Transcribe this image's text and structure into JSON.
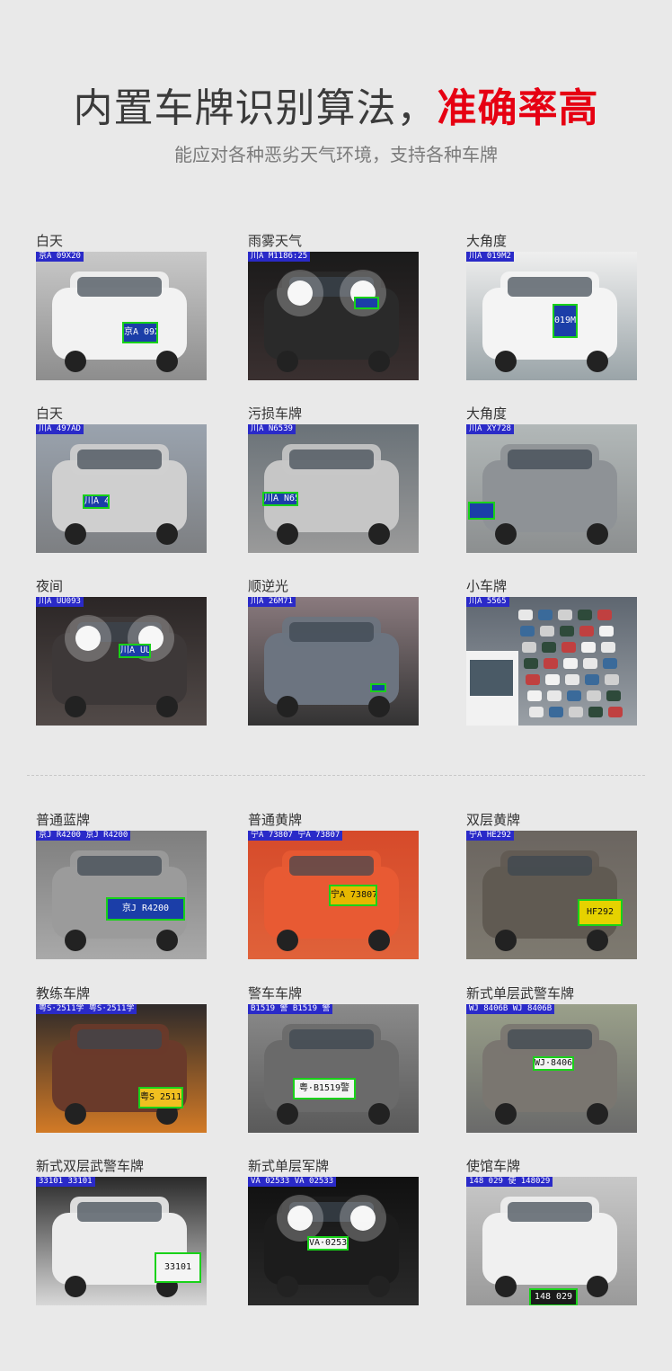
{
  "hero": {
    "title_main": "内置车牌识别算法，",
    "title_accent": "准确率高",
    "subtitle": "能应对各种恶劣天气环境，支持各种车牌",
    "accent_color": "#e60012"
  },
  "conditions": [
    {
      "label": "白天",
      "overlay": "京A 09X20",
      "plate": "京A 09X20"
    },
    {
      "label": "雨雾天气",
      "overlay": "川A M1186:25",
      "plate": ""
    },
    {
      "label": "大角度",
      "overlay": "川A 019M2",
      "plate": "019M2"
    },
    {
      "label": "白天",
      "overlay": "川A 497AD",
      "plate": "川A 497AD"
    },
    {
      "label": "污损车牌",
      "overlay": "川A N6539",
      "plate": "川A N6539"
    },
    {
      "label": "大角度",
      "overlay": "川A XY728",
      "plate": ""
    },
    {
      "label": "夜间",
      "overlay": "川A UU093",
      "plate": "川A UU093"
    },
    {
      "label": "顺逆光",
      "overlay": "川A 26M71",
      "plate": ""
    },
    {
      "label": "小车牌",
      "overlay": "川A 5565",
      "plate": ""
    }
  ],
  "plate_types": [
    {
      "label": "普通蓝牌",
      "overlay": "京J R4200 京J R4200",
      "plate": "京J R4200"
    },
    {
      "label": "普通黄牌",
      "overlay": "宁A 73807 宁A 73807",
      "plate": "宁A 73807"
    },
    {
      "label": "双层黄牌",
      "overlay": "宁A HE292",
      "plate": "HF292"
    },
    {
      "label": "教练车牌",
      "overlay": "粤S·2511学 粤S·2511学",
      "plate": "粤S 2511学"
    },
    {
      "label": "警车车牌",
      "overlay": "B1519 警 B1519 警",
      "plate": "粤·B1519警"
    },
    {
      "label": "新式单层武警车牌",
      "overlay": "WJ 8406B WJ 8406B",
      "plate": "WJ·8406B"
    },
    {
      "label": "新式双层武警车牌",
      "overlay": "33101 33101",
      "plate": "33101"
    },
    {
      "label": "新式单层军牌",
      "overlay": "VA 02533 VA 02533",
      "plate": "VA·02533"
    },
    {
      "label": "使馆车牌",
      "overlay": "148 029 使 148029",
      "plate": "148 029"
    }
  ]
}
